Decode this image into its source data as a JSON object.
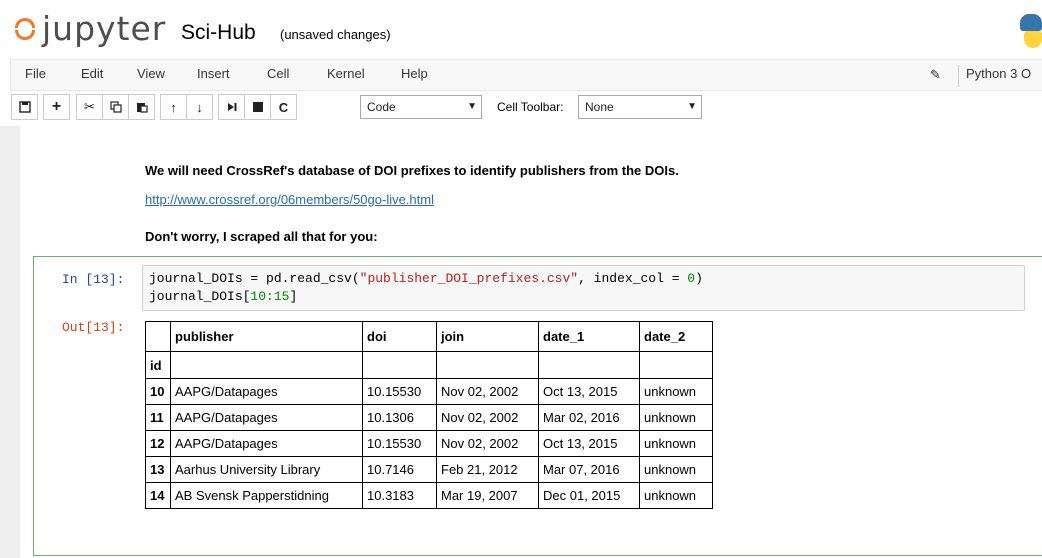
{
  "header": {
    "logo_text": "jupyter",
    "notebook_name": "Sci-Hub",
    "notebook_status": "(unsaved changes)"
  },
  "menubar": {
    "items": [
      "File",
      "Edit",
      "View",
      "Insert",
      "Cell",
      "Kernel",
      "Help"
    ],
    "kernel": "Python 3",
    "kernel_indicator": "O"
  },
  "toolbar": {
    "buttons": [
      "save-icon",
      "plus-icon",
      "cut-icon",
      "copy-icon",
      "paste-icon",
      "arrow-up-icon",
      "arrow-down-icon",
      "skip-next-icon",
      "stop-icon",
      "restart-icon"
    ],
    "cell_type": "Code",
    "cell_toolbar_label": "Cell Toolbar:",
    "cell_toolbar_value": "None"
  },
  "markdown": {
    "line1": "We will need CrossRef's database of DOI prefixes to identify publishers from the DOIs.",
    "link": "http://www.crossref.org/06members/50go-live.html",
    "line2": "Don't worry, I scraped all that for you:"
  },
  "cell": {
    "in_prompt": "In [13]:",
    "out_prompt": "Out[13]:",
    "code_line1_a": "journal_DOIs = pd.read_csv(",
    "code_line1_str": "\"publisher_DOI_prefixes.csv\"",
    "code_line1_b": ", index_col = ",
    "code_line1_num": "0",
    "code_line1_c": ")",
    "code_line2_a": "journal_DOIs[",
    "code_line2_num": "10:15",
    "code_line2_b": "]"
  },
  "table": {
    "columns": [
      "publisher",
      "doi",
      "join",
      "date_1",
      "date_2"
    ],
    "index_name": "id",
    "rows": [
      {
        "id": "10",
        "publisher": "AAPG/Datapages",
        "doi": "10.15530",
        "join": "Nov 02, 2002",
        "date_1": "Oct 13, 2015",
        "date_2": "unknown"
      },
      {
        "id": "11",
        "publisher": "AAPG/Datapages",
        "doi": "10.1306",
        "join": "Nov 02, 2002",
        "date_1": "Mar 02, 2016",
        "date_2": "unknown"
      },
      {
        "id": "12",
        "publisher": "AAPG/Datapages",
        "doi": "10.15530",
        "join": "Nov 02, 2002",
        "date_1": "Oct 13, 2015",
        "date_2": "unknown"
      },
      {
        "id": "13",
        "publisher": "Aarhus University Library",
        "doi": "10.7146",
        "join": "Feb 21, 2012",
        "date_1": "Mar 07, 2016",
        "date_2": "unknown"
      },
      {
        "id": "14",
        "publisher": "AB Svensk Papperstidning",
        "doi": "10.3183",
        "join": "Mar 19, 2007",
        "date_1": "Dec 01, 2015",
        "date_2": "unknown"
      }
    ]
  },
  "colors": {
    "logo_orange": "#f37726",
    "cell_border": "#66bb6a",
    "in_prompt": "#303f9f",
    "out_prompt": "#d84315",
    "link": "#296eaa"
  }
}
